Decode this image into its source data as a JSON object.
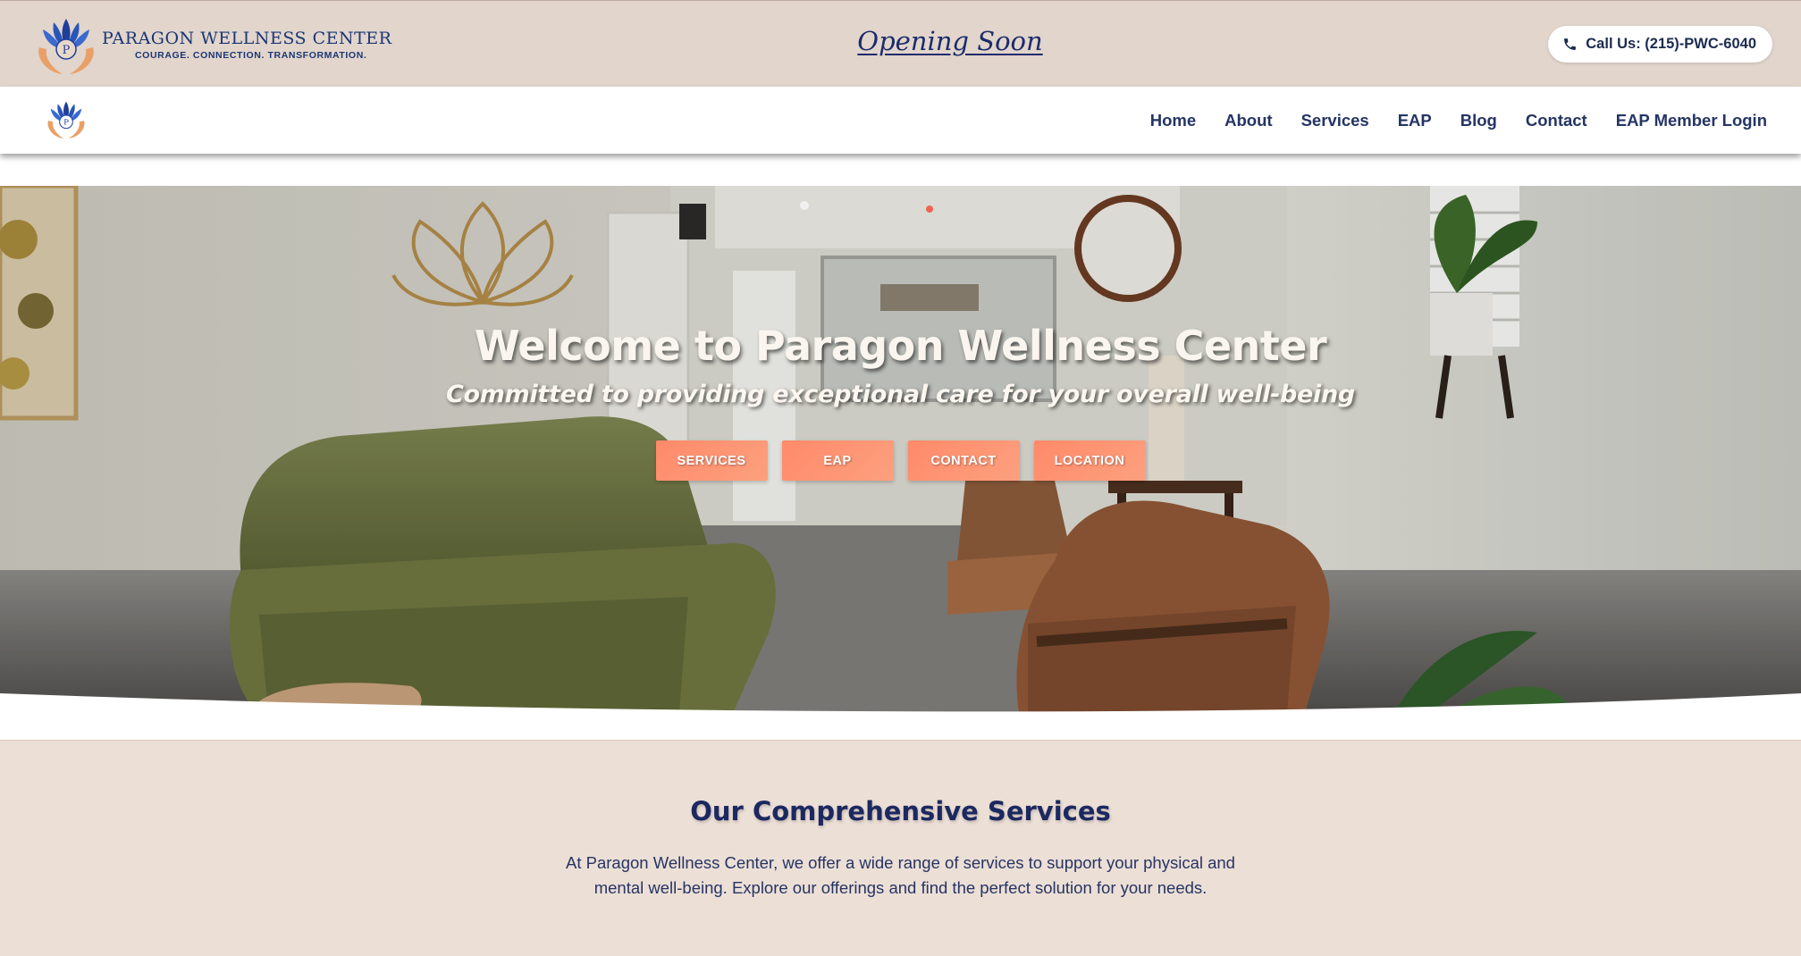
{
  "topbar": {
    "brand_name": "PARAGON WELLNESS CENTER",
    "brand_tagline": "COURAGE. CONNECTION. TRANSFORMATION.",
    "announcement": "Opening Soon",
    "call_label": "Call Us: (215)-PWC-6040",
    "icons": {
      "logo": "lotus-hands-logo",
      "phone": "phone-icon"
    }
  },
  "nav": {
    "items": [
      {
        "label": "Home"
      },
      {
        "label": "About"
      },
      {
        "label": "Services"
      },
      {
        "label": "EAP"
      },
      {
        "label": "Blog"
      },
      {
        "label": "Contact"
      },
      {
        "label": "EAP Member Login"
      }
    ]
  },
  "hero": {
    "title": "Welcome to Paragon Wellness Center",
    "subtitle": "Committed to providing exceptional care for your overall well-being",
    "buttons": [
      {
        "label": "SERVICES"
      },
      {
        "label": "EAP"
      },
      {
        "label": "CONTACT"
      },
      {
        "label": "LOCATION"
      }
    ]
  },
  "services": {
    "title": "Our Comprehensive Services",
    "description": "At Paragon Wellness Center, we offer a wide range of services to support your physical and mental well-being. Explore our offerings and find the perfect solution for your needs."
  },
  "colors": {
    "topbar_bg": "#e1d5cc",
    "navy": "#1c2b6a",
    "accent_coral": "#ff8a6a",
    "section_bg": "#ecdfd6"
  }
}
